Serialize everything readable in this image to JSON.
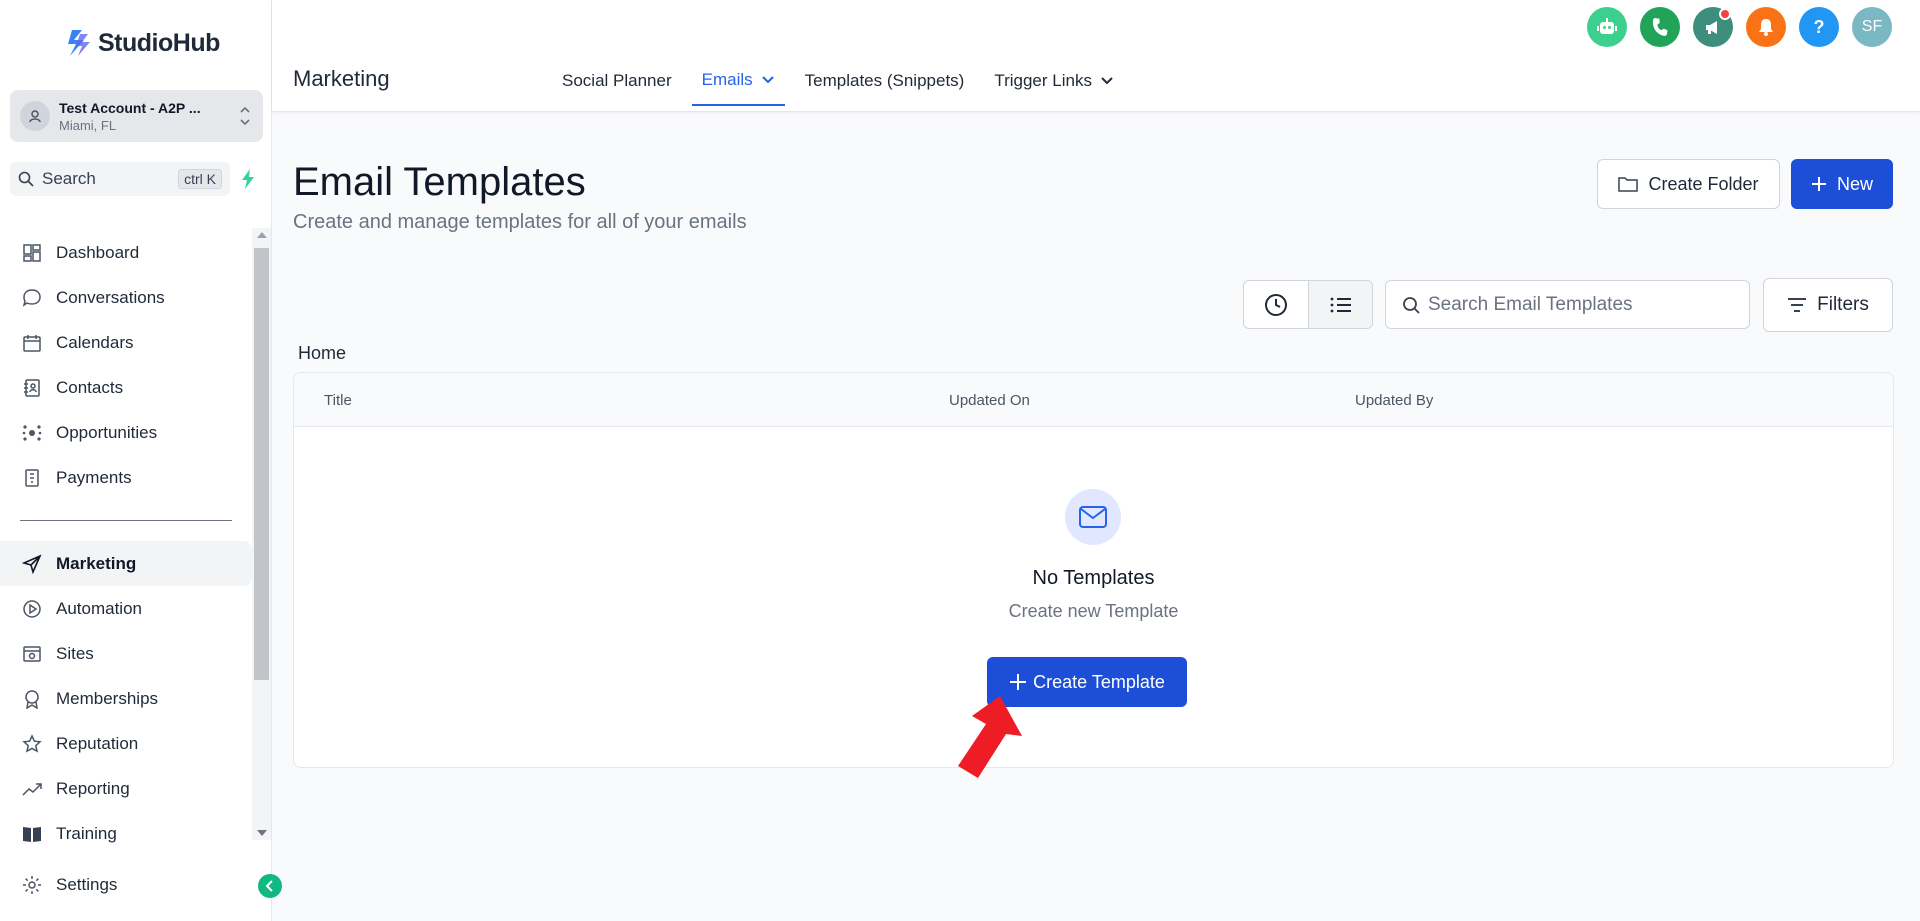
{
  "app": {
    "logo_text": "StudioHub",
    "account_name": "Test Account - A2P ...",
    "account_location": "Miami, FL",
    "search_label": "Search",
    "search_shortcut": "ctrl K"
  },
  "sidebar": {
    "items": [
      {
        "label": "Dashboard",
        "icon": "dashboard-icon"
      },
      {
        "label": "Conversations",
        "icon": "chat-icon"
      },
      {
        "label": "Calendars",
        "icon": "calendar-icon"
      },
      {
        "label": "Contacts",
        "icon": "contacts-icon"
      },
      {
        "label": "Opportunities",
        "icon": "opportunities-icon"
      },
      {
        "label": "Payments",
        "icon": "payments-icon"
      }
    ],
    "items2": [
      {
        "label": "Marketing",
        "icon": "send-icon",
        "active": true
      },
      {
        "label": "Automation",
        "icon": "automation-icon"
      },
      {
        "label": "Sites",
        "icon": "sites-icon"
      },
      {
        "label": "Memberships",
        "icon": "award-icon"
      },
      {
        "label": "Reputation",
        "icon": "star-icon"
      },
      {
        "label": "Reporting",
        "icon": "trend-icon"
      },
      {
        "label": "Training",
        "icon": "book-icon"
      }
    ],
    "settings_label": "Settings"
  },
  "header": {
    "section_title": "Marketing",
    "tabs": [
      {
        "label": "Social Planner"
      },
      {
        "label": "Emails",
        "active": true
      },
      {
        "label": "Templates (Snippets)"
      },
      {
        "label": "Trigger Links"
      }
    ],
    "avatar_initials": "SF",
    "help_glyph": "?",
    "icon_colors": {
      "bot": "#3ccf8e",
      "phone": "#22a35a",
      "megaphone": "#3e8e7e",
      "bell": "#f97316",
      "help": "#2196f3",
      "avatar": "#7ab8c4"
    }
  },
  "main": {
    "title": "Email Templates",
    "subtitle": "Create and manage templates for all of your emails",
    "create_folder_label": "Create Folder",
    "new_label": "New",
    "search_placeholder": "Search Email Templates",
    "filters_label": "Filters",
    "breadcrumb": "Home",
    "columns": [
      "Title",
      "Updated On",
      "Updated By"
    ],
    "empty_title": "No Templates",
    "empty_subtitle": "Create new Template",
    "create_template_label": "Create Template"
  },
  "colors": {
    "primary": "#1d4ed8",
    "accent_tab": "#2563eb",
    "annotation_arrow": "#ee1c24"
  }
}
